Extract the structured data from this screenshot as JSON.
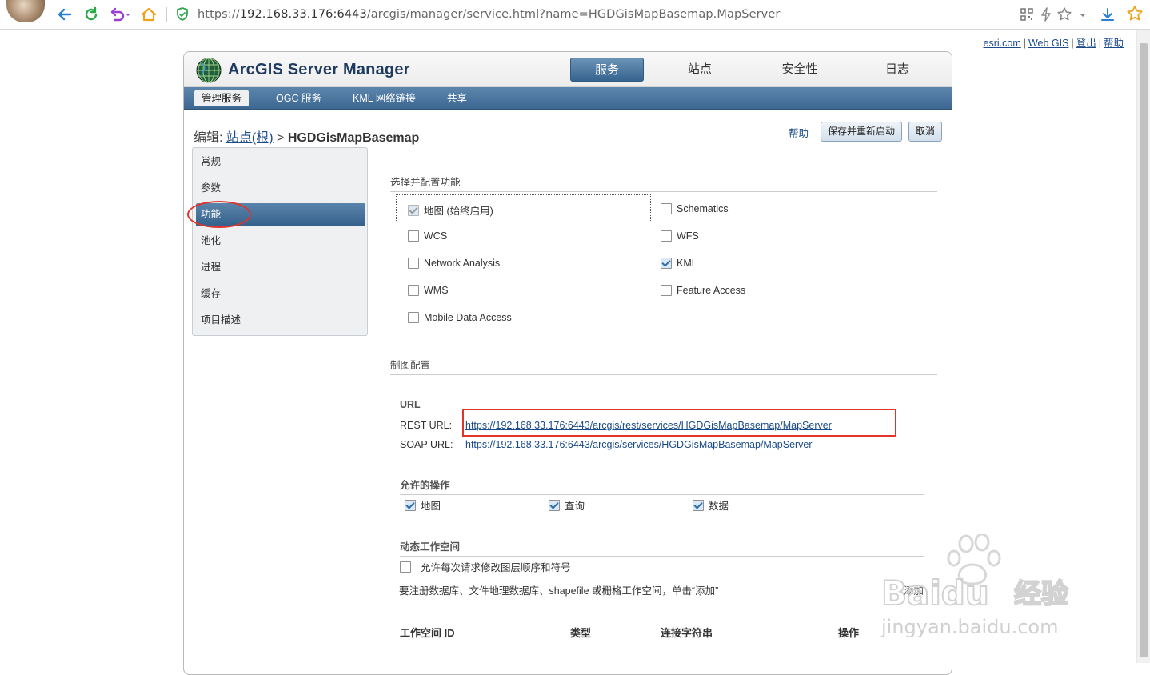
{
  "browser": {
    "url_prefix": "https://",
    "url_host": "192.168.33.176:6443",
    "url_path": "/arcgis/manager/service.html?name=HGDGisMapBasemap.MapServer"
  },
  "top_links": {
    "esri": "esri.com",
    "webgis": "Web GIS",
    "logout": "登出",
    "help": "帮助"
  },
  "app": {
    "title": "ArcGIS Server Manager",
    "main_tabs": [
      "服务",
      "站点",
      "安全性",
      "日志"
    ],
    "sub_tabs": [
      "管理服务",
      "OGC 服务",
      "KML 网络链接",
      "共享"
    ]
  },
  "edit": {
    "prefix": "编辑:",
    "root_link": "站点(根)",
    "arrow": ">",
    "service": "HGDGisMapBasemap",
    "help": "帮助",
    "save_restart": "保存并重新启动",
    "cancel": "取消"
  },
  "left_menu": [
    "常规",
    "参数",
    "功能",
    "池化",
    "进程",
    "缓存",
    "项目描述"
  ],
  "capabilities": {
    "heading": "选择并配置功能",
    "items": [
      {
        "label": "地图 (始终启用)",
        "checked": true,
        "disabled": true
      },
      {
        "label": "Schematics",
        "checked": false
      },
      {
        "label": "WCS",
        "checked": false
      },
      {
        "label": "WFS",
        "checked": false
      },
      {
        "label": "Network Analysis",
        "checked": false
      },
      {
        "label": "KML",
        "checked": true
      },
      {
        "label": "WMS",
        "checked": false
      },
      {
        "label": "Feature Access",
        "checked": false
      },
      {
        "label": "Mobile Data Access",
        "checked": false
      }
    ]
  },
  "mapping": {
    "heading": "制图配置",
    "url_heading": "URL",
    "rest_label": "REST URL:",
    "rest_url": "https://192.168.33.176:6443/arcgis/rest/services/HGDGisMapBasemap/MapServer",
    "soap_label": "SOAP URL:",
    "soap_url": "https://192.168.33.176:6443/arcgis/services/HGDGisMapBasemap/MapServer",
    "ops_heading": "允许的操作",
    "ops": [
      {
        "label": "地图",
        "checked": true
      },
      {
        "label": "查询",
        "checked": true
      },
      {
        "label": "数据",
        "checked": true
      }
    ],
    "dyn_heading": "动态工作空间",
    "dyn_allow": "允许每次请求修改图层顺序和符号",
    "dyn_note": "要注册数据库、文件地理数据库、shapefile 或栅格工作空间，单击“添加”",
    "add_button": "添加",
    "table_headers": [
      "工作空间 ID",
      "类型",
      "连接字符串",
      "操作"
    ]
  },
  "watermark": {
    "brand": "Baidu",
    "cn": "经验",
    "site": "jingyan.baidu.com"
  },
  "colors": {
    "accent": "#35648f",
    "highlight": "#e2342b",
    "link": "#1b4b8a"
  }
}
